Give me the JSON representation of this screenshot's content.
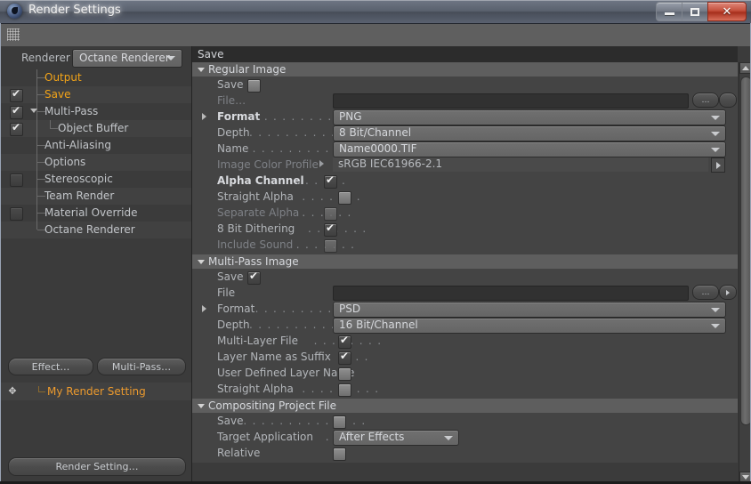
{
  "window": {
    "title": "Render Settings",
    "icon": "cinema4d-logo-icon",
    "controls": {
      "minimize": "—",
      "maximize": "▭",
      "close": "✕"
    }
  },
  "sidebar": {
    "renderer_label": "Renderer",
    "renderer_value": "Octane Renderer",
    "tree": [
      {
        "label": "Output",
        "checkbox": "none",
        "selected": true,
        "indent": 1
      },
      {
        "label": "Save",
        "checkbox": "checked",
        "selected": true,
        "indent": 1
      },
      {
        "label": "Multi-Pass",
        "checkbox": "checked",
        "selected": false,
        "indent": 1,
        "expander": true
      },
      {
        "label": "Object Buffer",
        "checkbox": "checked",
        "selected": false,
        "indent": 2
      },
      {
        "label": "Anti-Aliasing",
        "checkbox": "none",
        "selected": false,
        "indent": 1
      },
      {
        "label": "Options",
        "checkbox": "none",
        "selected": false,
        "indent": 1
      },
      {
        "label": "Stereoscopic",
        "checkbox": "empty",
        "selected": false,
        "indent": 1
      },
      {
        "label": "Team Render",
        "checkbox": "none",
        "selected": false,
        "indent": 1
      },
      {
        "label": "Material Override",
        "checkbox": "empty",
        "selected": false,
        "indent": 1
      },
      {
        "label": "Octane Renderer",
        "checkbox": "none",
        "selected": false,
        "indent": 1,
        "last": true
      }
    ],
    "buttons": {
      "effect": "Effect…",
      "multipass": "Multi-Pass…"
    },
    "current_setting": {
      "label": "My Render Setting",
      "icon": "move-icon"
    },
    "bottom_button": "Render Setting…"
  },
  "panel": {
    "title": "Save",
    "groups": [
      {
        "name": "Regular Image",
        "expanded": true,
        "rows": [
          {
            "type": "checkbox",
            "label": "Save",
            "dots": "",
            "checked": false,
            "dim": false,
            "bold": false
          },
          {
            "type": "field",
            "label": "File…",
            "value": "",
            "dim": true,
            "buttons": [
              "…",
              "circle"
            ]
          },
          {
            "type": "combo",
            "label": "Format",
            "dots": ". . . . . . . . . . . . .",
            "value": "PNG",
            "bold": true,
            "expander": true
          },
          {
            "type": "combo",
            "label": "Depth",
            "dots": ". . . . . . . . . . . . .",
            "value": "8 Bit/Channel"
          },
          {
            "type": "combo",
            "label": "Name",
            "dots": ". . . . . . . . . . . . .",
            "value": "Name0000.TIF"
          },
          {
            "type": "flat",
            "label": "Image Color Profile",
            "value": "sRGB IEC61966-2.1",
            "dim": true,
            "inline_arrow": true,
            "end_arrow": true
          },
          {
            "type": "checkbox",
            "label": "Alpha Channel",
            "dots": ". . . . . .",
            "checked": true,
            "bold": true
          },
          {
            "type": "checkbox",
            "label": "Straight Alpha",
            "dots": ". . . . . . .",
            "checked": false
          },
          {
            "type": "checkbox",
            "label": "Separate Alpha",
            "dots": ". . . . . .",
            "checked": false,
            "dim": true
          },
          {
            "type": "checkbox",
            "label": "8 Bit Dithering",
            "dots": ". . . . . . .",
            "checked": true
          },
          {
            "type": "checkbox",
            "label": "Include Sound",
            "dots": ". . . . . . .",
            "checked": false,
            "dim": true
          }
        ]
      },
      {
        "name": "Multi-Pass Image",
        "expanded": true,
        "rows": [
          {
            "type": "checkbox",
            "label": "Save",
            "dots": "",
            "checked": true
          },
          {
            "type": "field",
            "label": "File",
            "value": "",
            "buttons": [
              "…",
              "arrow"
            ]
          },
          {
            "type": "combo",
            "label": "Format",
            "dots": ". . . . . . . . . . . . .",
            "value": "PSD",
            "expander": true
          },
          {
            "type": "combo",
            "label": "Depth",
            "dots": ". . . . . . . . . . . . .",
            "value": "16 Bit/Channel"
          },
          {
            "type": "checkbox",
            "label": "Multi-Layer File",
            "dots": ". . . . . . . .",
            "checked": true
          },
          {
            "type": "checkbox",
            "label": "Layer Name as Suffix",
            "dots": ". . . .",
            "checked": true
          },
          {
            "type": "checkbox",
            "label": "User Defined Layer Name",
            "dots": "",
            "checked": false
          },
          {
            "type": "checkbox",
            "label": "Straight Alpha",
            "dots": ". . . . . . . . .",
            "checked": false
          }
        ]
      },
      {
        "name": "Compositing Project File",
        "expanded": true,
        "rows": [
          {
            "type": "checkbox",
            "label": "Save",
            "dots": ". . . . . . . . . . . . . .",
            "checked": false
          },
          {
            "type": "combo",
            "label": "Target Application",
            "dots": ". . . .",
            "value": "After Effects",
            "narrow": true
          },
          {
            "type": "checkbox",
            "label": "Relative",
            "dots": "",
            "checked": false,
            "clipped": true
          }
        ]
      }
    ]
  },
  "scrollbar": {
    "up": "▲",
    "down": "▼"
  }
}
